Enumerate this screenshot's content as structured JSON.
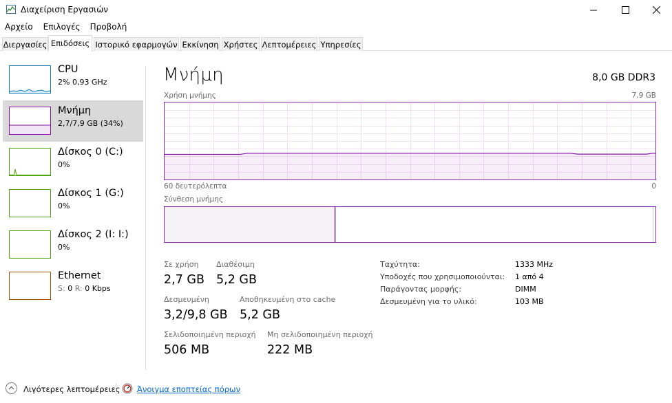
{
  "window": {
    "title": "Διαχείριση Εργασιών",
    "icon": "task-manager-icon"
  },
  "menu": [
    "Αρχείο",
    "Επιλογές",
    "Προβολή"
  ],
  "tabs": [
    "Διεργασίες",
    "Επιδόσεις",
    "Ιστορικό εφαρμογών",
    "Εκκίνηση",
    "Χρήστες",
    "Λεπτομέρειες",
    "Υπηρεσίες"
  ],
  "active_tab": "Επιδόσεις",
  "sidebar": {
    "items": [
      {
        "title": "CPU",
        "sub": "2%  0,93 GHz",
        "color": "#117dbb"
      },
      {
        "title": "Μνήμη",
        "sub": "2,7/7,9 GB (34%)",
        "color": "#8b12ae",
        "selected": true
      },
      {
        "title": "Δίσκος 0 (C:)",
        "sub": "0%",
        "color": "#4da60c"
      },
      {
        "title": "Δίσκος 1 (G:)",
        "sub": "0%",
        "color": "#4da60c"
      },
      {
        "title": "Δίσκος 2 (I: I:)",
        "sub": "0%",
        "color": "#4da60c"
      },
      {
        "title": "Ethernet",
        "sub_s": "S:",
        "sub_s_val": "0",
        "sub_r": "R:",
        "sub_r_val": "0 Kbps",
        "color": "#a74f01"
      }
    ]
  },
  "main": {
    "title": "Μνήμη",
    "spec": "8,0 GB DDR3",
    "usage_label": "Χρήση μνήμης",
    "usage_max": "7,9 GB",
    "time_left": "60 δευτερόλεπτα",
    "time_right": "0",
    "composition_label": "Σύνθεση μνήμης",
    "accent": "#8b12ae",
    "usage_fraction": 0.34
  },
  "stats": {
    "in_use_label": "Σε χρήση",
    "in_use": "2,7 GB",
    "available_label": "Διαθέσιμη",
    "available": "5,2 GB",
    "committed_label": "Δεσμευμένη",
    "committed": "3,2/9,8 GB",
    "cached_label": "Αποθηκευμένη στο cache",
    "cached": "5,2 GB",
    "paged_label": "Σελιδοποιημένη περιοχή",
    "paged": "506 MB",
    "nonpaged_label": "Μη σελιδοποιημένη περιοχή",
    "nonpaged": "222 MB"
  },
  "info": {
    "speed_label": "Ταχύτητα:",
    "speed": "1333 MHz",
    "slots_label": "Υποδοχές που χρησιμοποιούνται:",
    "slots": "1 από 4",
    "form_label": "Παράγοντας μορφής:",
    "form": "DIMM",
    "reserved_label": "Δεσμευμένη για το υλικό:",
    "reserved": "103 MB"
  },
  "footer": {
    "fewer_details": "Λιγότερες λεπτομέρειες",
    "open_monitor": "Άνοιγμα εποπτείας πόρων"
  }
}
